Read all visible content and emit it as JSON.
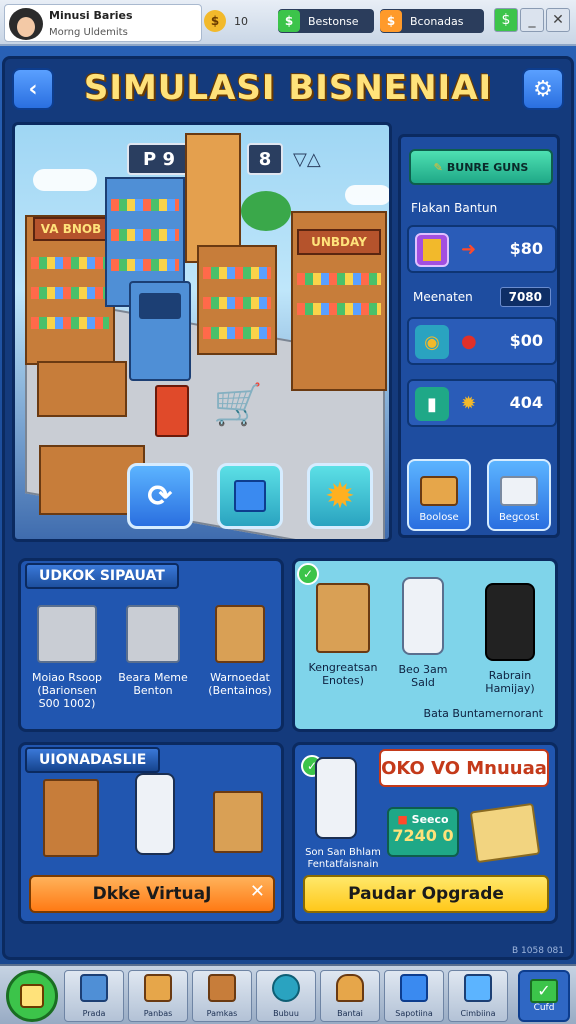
{
  "topbar": {
    "player_name": "Minusi Baries",
    "player_sub": "Morng Uldemits",
    "gold_value": "10",
    "res1_label": "Bestonse",
    "res2_label": "Bconadas"
  },
  "window_buttons": [
    "_",
    "✕"
  ],
  "header": {
    "title": "SIMULASI BISNENIAI",
    "back_icon": "back-arrow-icon",
    "settings_icon": "gear-icon"
  },
  "scene": {
    "counter_left": "P 9",
    "counter_right": "8",
    "sign_left": "VA BNOB",
    "sign_right": "UNBDAY",
    "actions": [
      "finance",
      "stock",
      "upgrade"
    ]
  },
  "side_panel": {
    "header_label": "BUNRE GUNS",
    "section_label": "Flakan Bantun",
    "rows": [
      {
        "icon": "gold-bar-icon",
        "value": "$80"
      },
      {
        "icon": "money-bag-icon",
        "value": "$00"
      },
      {
        "icon": "gear-icon",
        "value": "404"
      }
    ],
    "meta_label": "Meenaten",
    "meta_value": "7080",
    "tiles": [
      {
        "label": "Boolose"
      },
      {
        "label": "Begcost"
      }
    ]
  },
  "stock_section": {
    "title": "UDKOK SIPAUAT",
    "items": [
      {
        "line1": "Moiao Rsoop",
        "line2": "(Barionsen",
        "line3": "S00 1002)"
      },
      {
        "line1": "Beara Meme",
        "line2": "Benton",
        "line3": ""
      },
      {
        "line1": "Warnoedat",
        "line2": "(Bentainos)",
        "line3": ""
      }
    ]
  },
  "devices_section": {
    "items": [
      {
        "line1": "Kengreatsan",
        "line2": "Enotes)"
      },
      {
        "line1": "Beo 3am",
        "line2": "Sald"
      },
      {
        "line1": "Rabrain",
        "line2": "Hamijay)"
      }
    ],
    "caption": "Bata Buntamernorant"
  },
  "virtual_section": {
    "title": "UIONADASLIE",
    "button_label": "Dkke VirtuaJ",
    "close_icon": "close-icon"
  },
  "upgrade_section": {
    "banner": "OKO VO Mnuuaa",
    "item_line1": "Son San Bhlam",
    "item_line2": "Fentatfaisnain",
    "price_label": "Seeco",
    "price_value": "7240 0",
    "button_label": "Paudar Opgrade"
  },
  "footer_text": "B 1058 081",
  "bottom_nav": [
    {
      "label": "Prada",
      "icon": "box-icon"
    },
    {
      "label": "Panbas",
      "icon": "crate-icon"
    },
    {
      "label": "Pamkas",
      "icon": "shelf-icon"
    },
    {
      "label": "Bubuu",
      "icon": "coin-icon"
    },
    {
      "label": "Bantai",
      "icon": "bag-icon"
    },
    {
      "label": "Sapotiina",
      "icon": "package-icon"
    },
    {
      "label": "Cimbiina",
      "icon": "gift-icon"
    }
  ],
  "nav_final_label": "Cufd",
  "colors": {
    "title": "#ffe27a",
    "accent_green": "#3cc44a",
    "upgrade_yellow": "#ffd93a",
    "virtual_orange": "#ff8a1f"
  }
}
